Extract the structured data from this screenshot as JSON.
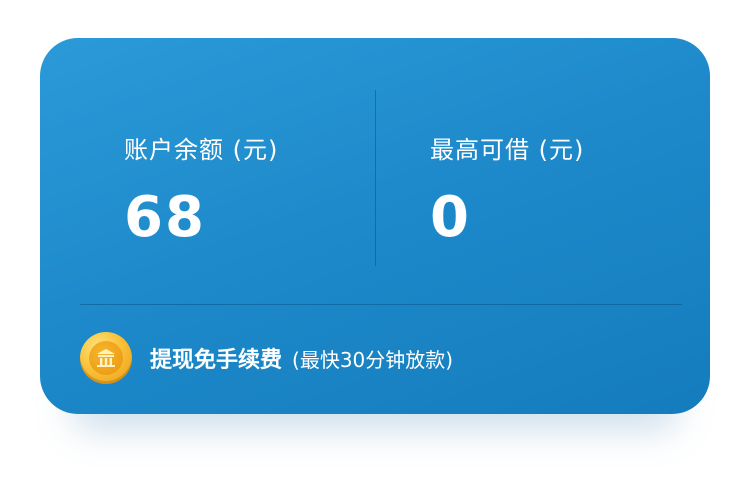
{
  "balance": {
    "label": "账户余额 (元)",
    "value": "68"
  },
  "max_borrow": {
    "label": "最高可借 (元)",
    "value": "0"
  },
  "promo": {
    "icon": "coin-icon",
    "title": "提现免手续费",
    "note": "(最快30分钟放款)"
  },
  "colors": {
    "card_gradient_start": "#2b9ad8",
    "card_gradient_end": "#147cbc",
    "coin": "#f9c23a",
    "text": "#ffffff"
  }
}
